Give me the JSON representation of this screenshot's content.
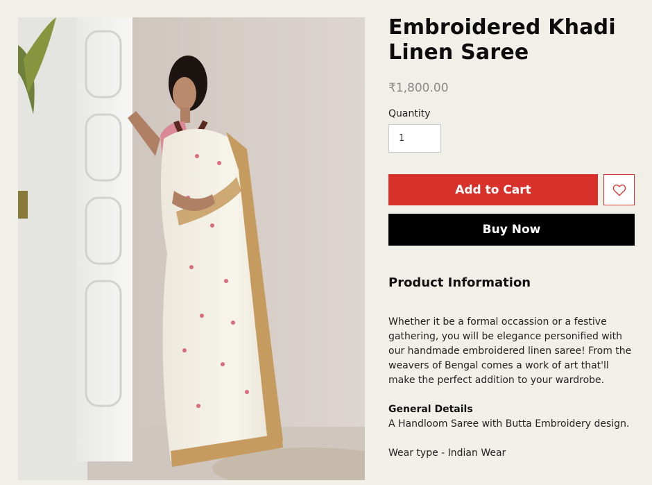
{
  "product": {
    "title": "Embroidered Khadi Linen Saree",
    "price": "₹1,800.00",
    "image_alt": "Woman wearing a white embroidered khadi linen saree",
    "quantity_label": "Quantity",
    "quantity_value": "1"
  },
  "actions": {
    "add_to_cart_label": "Add to Cart",
    "buy_now_label": "Buy Now",
    "wishlist_icon": "heart-icon"
  },
  "info": {
    "heading": "Product Information",
    "description": "Whether it be a formal occassion or a festive gathering, you will be elegance personified with our handmade embroidered linen saree! From the weavers of Bengal comes a work of art that'll make the perfect addition to your wardrobe.",
    "general_details_title": "General Details",
    "general_details_text": "A Handloom Saree with Butta Embroidery design.",
    "wear_type": "Wear type - Indian Wear"
  },
  "colors": {
    "page_background": "#f0efe8",
    "add_to_cart": "#d8302a",
    "buy_now": "#000000",
    "price_text": "#8a8a8a"
  }
}
